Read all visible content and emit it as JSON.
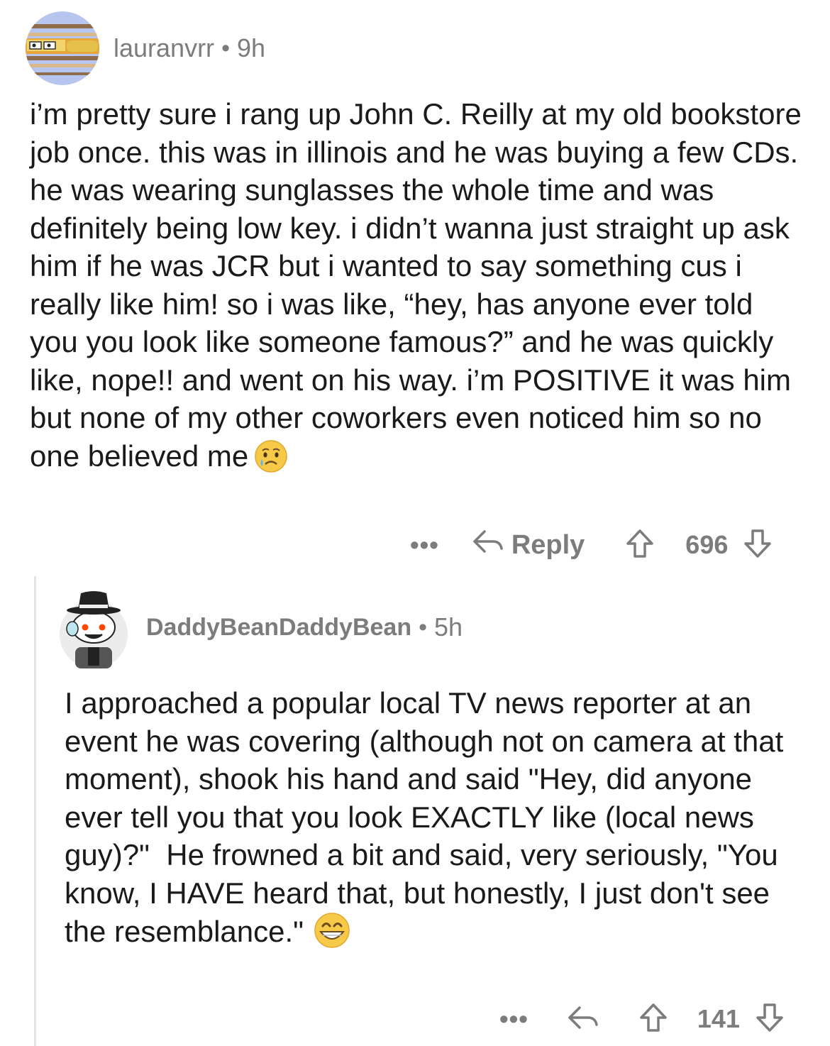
{
  "comments": [
    {
      "username": "lauranvrr",
      "separator": "•",
      "time": "9h",
      "avatar_icon": "sunglasses-character-avatar-icon",
      "body": "i’m pretty sure i rang up John C. Reilly at my old bookstore job once. this was in illinois and he was buying a few CDs. he was wearing sunglasses the whole time and was definitely being low key. i didn’t wanna just straight up ask him if he was JCR but i wanted to say something cus i really like him! so i was like, “hey, has anyone ever told you you look like someone famous?” and he was quickly like, nope!! and went on his way. i’m POSITIVE it was him but none of my other coworkers even noticed him so no one believed me",
      "emoji": "crying-face-emoji",
      "actions": {
        "more": "•••",
        "reply_label": "Reply",
        "votes": "696"
      }
    },
    {
      "username": "DaddyBeanDaddyBean",
      "separator": "•",
      "time": "5h",
      "avatar_icon": "snoo-fedora-avatar-icon",
      "body": "I approached a popular local TV news reporter at an event he was covering (although not on camera at that moment), shook his hand and said \"Hey, did anyone ever tell you that you look EXACTLY like (local news guy)?\"  He frowned a bit and said, very seriously, \"You know, I HAVE heard that, but honestly, I just don't see the resemblance.\"",
      "emoji": "grinning-face-emoji",
      "actions": {
        "more": "•••",
        "reply_label": "",
        "votes": "141"
      }
    }
  ],
  "colors": {
    "meta_gray": "#7c7c7c",
    "text": "#1a1a1b",
    "thread_line": "#e3e3e3"
  }
}
